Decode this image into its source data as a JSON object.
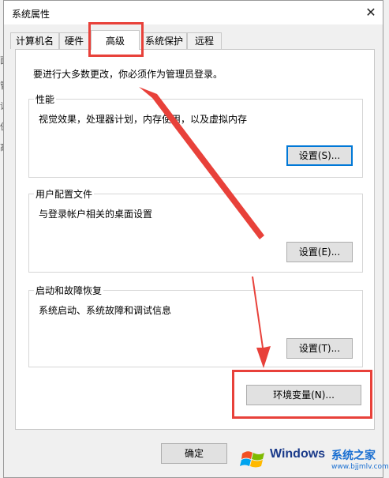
{
  "window": {
    "title": "系统属性",
    "close_glyph": "✕"
  },
  "tabs": [
    {
      "label": "计算机名"
    },
    {
      "label": "硬件"
    },
    {
      "label": "高级",
      "active": true
    },
    {
      "label": "系统保护"
    },
    {
      "label": "远程"
    }
  ],
  "notice": "要进行大多数更改，你必须作为管理员登录。",
  "sections": {
    "performance": {
      "title": "性能",
      "description": "视觉效果，处理器计划，内存使用，以及虚拟内存",
      "button": "设置(S)..."
    },
    "user_profiles": {
      "title": "用户配置文件",
      "description": "与登录帐户相关的桌面设置",
      "button": "设置(E)..."
    },
    "startup_recovery": {
      "title": "启动和故障恢复",
      "description": "系统启动、系统故障和调试信息",
      "button": "设置(T)..."
    }
  },
  "env_button": "环境变量(N)...",
  "footer": {
    "ok_button": "确定"
  },
  "watermark": {
    "brand": "Windows",
    "site_name": "系统之家",
    "url": "www.bjjmlv.com"
  },
  "colors": {
    "highlight": "#e8413a",
    "focus": "#0078d7",
    "dialog_bg": "#f0f0f0",
    "panel_bg": "#ffffff"
  }
}
